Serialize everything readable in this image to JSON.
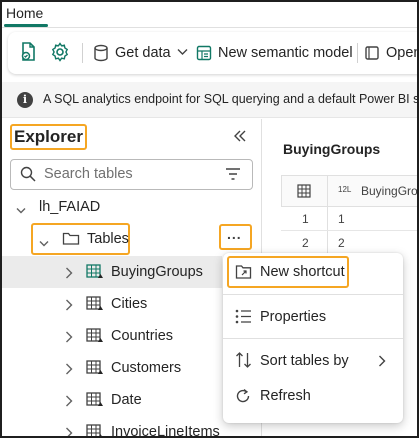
{
  "tabs": {
    "home": "Home"
  },
  "toolbar": {
    "get_data": "Get data",
    "new_semantic_model": "New semantic model",
    "open": "Open"
  },
  "banner": {
    "text": "A SQL analytics endpoint for SQL querying and a default Power BI sema"
  },
  "explorer": {
    "title": "Explorer",
    "search_placeholder": "Search tables",
    "lakehouse": "lh_FAIAD",
    "tables_folder": "Tables",
    "more_label": "...",
    "tables": [
      "BuyingGroups",
      "Cities",
      "Countries",
      "Customers",
      "Date",
      "InvoiceLineItems"
    ]
  },
  "preview": {
    "title": "BuyingGroups",
    "type_badge": "12L",
    "column_header": "BuyingGrou",
    "row_numbers": [
      "1",
      "2"
    ],
    "values": [
      "1",
      "2"
    ]
  },
  "context_menu": {
    "items": [
      "New shortcut",
      "Properties",
      "Sort tables by",
      "Refresh"
    ]
  },
  "colors": {
    "highlight": "#f5a623",
    "accent": "#117865",
    "selected_row": "#ebebeb"
  }
}
